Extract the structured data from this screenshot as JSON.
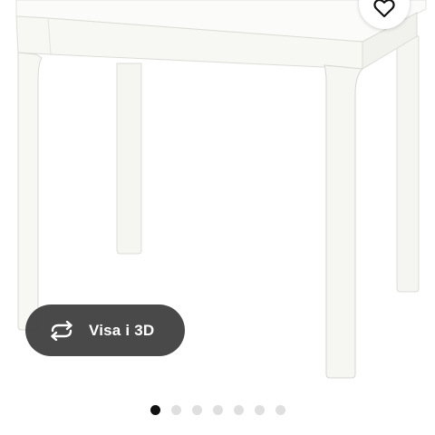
{
  "view_3d": {
    "label": "Visa i 3D",
    "icon": "rotate-arrows-icon"
  },
  "favorite": {
    "icon": "heart-icon"
  },
  "carousel": {
    "total_images": 7,
    "active_index": 0
  },
  "colors": {
    "button_bg": "#3a3a3a",
    "active_dot": "#111111",
    "inactive_dot": "#dfdfdf",
    "product": "#f7f7f4"
  }
}
